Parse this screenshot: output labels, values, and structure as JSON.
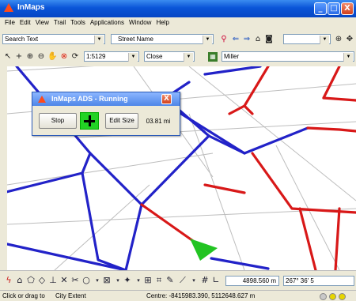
{
  "window": {
    "title": "InMaps",
    "minimize": "_",
    "maximize": "□",
    "close": "X"
  },
  "menu": [
    "File",
    "Edit",
    "View",
    "Trail",
    "Tools",
    "Applications",
    "Window",
    "Help"
  ],
  "toolbar1": {
    "search_value": "Search Text",
    "street_value": "Street Name",
    "third_value": ""
  },
  "toolbar2": {
    "scale": "1:5129",
    "close_value": "Close",
    "layer_value": "Miller"
  },
  "dialog": {
    "title": "InMaps ADS - Running",
    "stop_label": "Stop",
    "editsize_label": "Edit Size",
    "distance": "03.81 mi"
  },
  "bottom": {
    "distance_field": "4898.560 m",
    "angle_field": "267° 36' 5"
  },
  "status": {
    "left_label": "Click or drag to",
    "left_value": "City Extent",
    "centre": "Centre: -8415983.390, 5112648.627 m"
  },
  "colors": {
    "road_blue": "#2222c8",
    "road_red": "#d81818",
    "position_marker": "#22c422"
  },
  "icons": {
    "toolbar1": [
      "search-icon",
      "back-arrow-icon",
      "forward-arrow-icon",
      "home-icon",
      "binoculars-icon",
      "zoom-icon",
      "pan-icon"
    ],
    "toolbar2": [
      "pointer-icon",
      "crosshair-icon",
      "zoom-in-icon",
      "zoom-out-icon",
      "hand-icon",
      "stop-icon",
      "refresh-icon"
    ]
  }
}
